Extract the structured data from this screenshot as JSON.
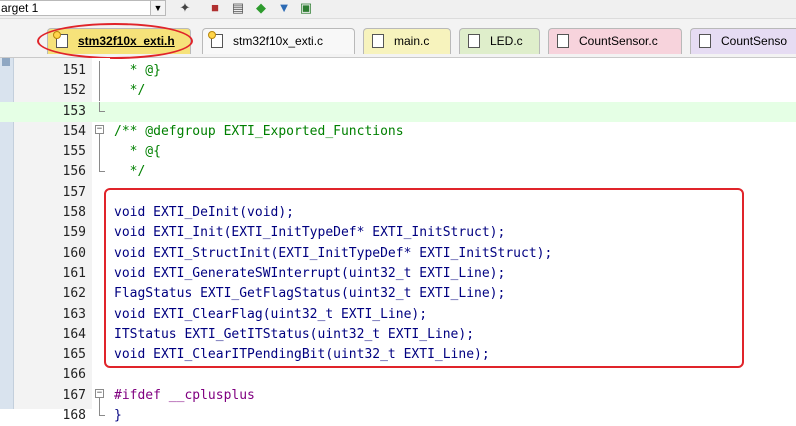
{
  "toolbar": {
    "target_label": "arget 1",
    "icons": [
      "dropdown-arrow-icon",
      "magic-wand-icon",
      "load-icon",
      "manage-icon",
      "diamond-icon",
      "options-icon",
      "multi-project-icon"
    ]
  },
  "tabs": [
    {
      "label": "stm32f10x_exti.h",
      "active": true,
      "color": "#f6e27a",
      "icon": "key-file-icon"
    },
    {
      "label": "stm32f10x_exti.c",
      "active": false,
      "color": "#f8f8f8",
      "icon": "key-file-icon"
    },
    {
      "label": "main.c",
      "active": false,
      "color": "#f7f3bd",
      "icon": "file-icon"
    },
    {
      "label": "LED.c",
      "active": false,
      "color": "#dfeecb",
      "icon": "file-icon"
    },
    {
      "label": "CountSensor.c",
      "active": false,
      "color": "#f7d3dc",
      "icon": "file-icon"
    },
    {
      "label": "CountSenso",
      "active": false,
      "color": "#e6dcf3",
      "icon": "file-icon"
    }
  ],
  "editor": {
    "lines": [
      {
        "n": "151",
        "text": "  * @}",
        "style": "comment"
      },
      {
        "n": "152",
        "text": "  */",
        "style": "comment"
      },
      {
        "n": "153",
        "text": "",
        "style": "code",
        "highlight": true
      },
      {
        "n": "154",
        "text": "/** @defgroup EXTI_Exported_Functions",
        "style": "comment"
      },
      {
        "n": "155",
        "text": "  * @{",
        "style": "comment"
      },
      {
        "n": "156",
        "text": "  */",
        "style": "comment"
      },
      {
        "n": "157",
        "text": "",
        "style": "code"
      },
      {
        "n": "158",
        "text": "void EXTI_DeInit(void);",
        "style": "code"
      },
      {
        "n": "159",
        "text": "void EXTI_Init(EXTI_InitTypeDef* EXTI_InitStruct);",
        "style": "code"
      },
      {
        "n": "160",
        "text": "void EXTI_StructInit(EXTI_InitTypeDef* EXTI_InitStruct);",
        "style": "code"
      },
      {
        "n": "161",
        "text": "void EXTI_GenerateSWInterrupt(uint32_t EXTI_Line);",
        "style": "code"
      },
      {
        "n": "162",
        "text": "FlagStatus EXTI_GetFlagStatus(uint32_t EXTI_Line);",
        "style": "code"
      },
      {
        "n": "163",
        "text": "void EXTI_ClearFlag(uint32_t EXTI_Line);",
        "style": "code"
      },
      {
        "n": "164",
        "text": "ITStatus EXTI_GetITStatus(uint32_t EXTI_Line);",
        "style": "code"
      },
      {
        "n": "165",
        "text": "void EXTI_ClearITPendingBit(uint32_t EXTI_Line);",
        "style": "code"
      },
      {
        "n": "166",
        "text": "",
        "style": "code"
      },
      {
        "n": "167",
        "text": "#ifdef __cplusplus",
        "style": "pre"
      },
      {
        "n": "168",
        "text": "}",
        "style": "code"
      }
    ]
  },
  "colors": {
    "annotation_red": "#e0242a",
    "comment_green": "#008000",
    "code_blue": "#000080",
    "preprocessor_purple": "#800080",
    "current_line": "#e5ffe5"
  }
}
